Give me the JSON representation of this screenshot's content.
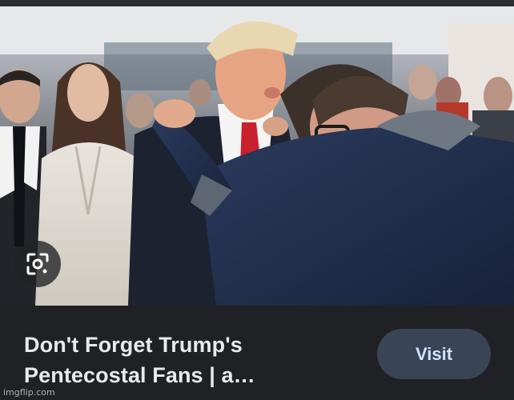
{
  "result_card": {
    "image_alt": "",
    "title_line_1": "Don't Forget Trump's",
    "title_line_2": "Pentecostal Fans | a…",
    "visit_label": "Visit",
    "lens_icon": "google-lens-icon"
  },
  "watermark": {
    "text": "imgflip.com"
  },
  "colors": {
    "background": "#202124",
    "title_text": "#e8eaed",
    "visit_button_bg": "#394457",
    "visit_button_text": "#d2e3fc"
  }
}
